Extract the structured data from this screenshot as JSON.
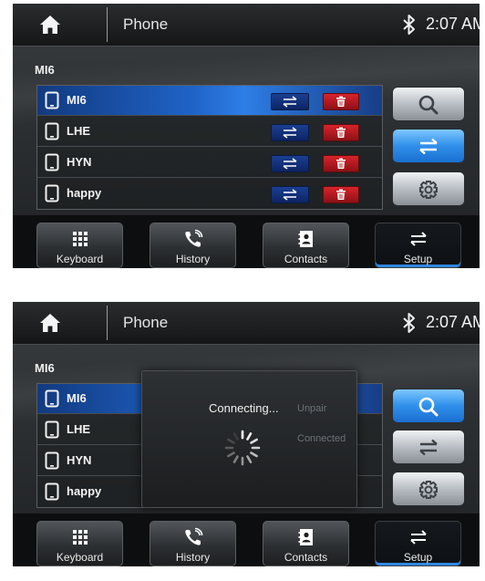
{
  "status_bar": {
    "app_title": "Phone",
    "time": "2:07 AM",
    "home_icon": "home-icon",
    "bluetooth_icon": "bluetooth-icon"
  },
  "device_label": "MI6",
  "devices": [
    {
      "label": "MI6",
      "selected": true
    },
    {
      "label": "LHE",
      "selected": false
    },
    {
      "label": "HYN",
      "selected": false
    },
    {
      "label": "happy",
      "selected": false
    }
  ],
  "side_buttons": [
    {
      "icon": "search-icon",
      "state": "normal"
    },
    {
      "icon": "transfer-icon",
      "state": "active"
    },
    {
      "icon": "gear-icon",
      "state": "normal"
    }
  ],
  "tabs": [
    {
      "label": "Keyboard",
      "icon": "keypad-icon"
    },
    {
      "label": "History",
      "icon": "call-history-icon"
    },
    {
      "label": "Contacts",
      "icon": "contacts-icon"
    },
    {
      "label": "Setup",
      "icon": "transfer-icon",
      "active": true
    }
  ],
  "overlay": {
    "message": "Connecting...",
    "ghost_unpair": "Unpair",
    "ghost_connected": "Connected"
  },
  "colors": {
    "selected_row": "#1f63c7",
    "connect_button": "#1b3f92",
    "delete_button": "#d6242b",
    "active_side_button": "#2f8fea"
  }
}
